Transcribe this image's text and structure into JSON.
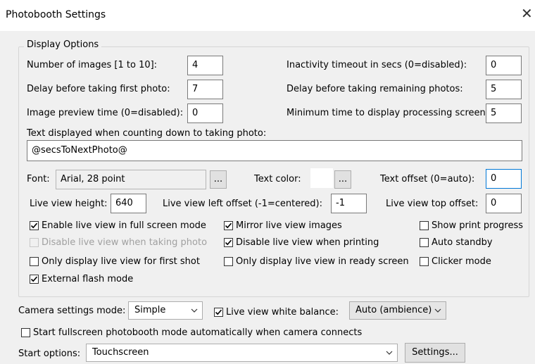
{
  "window": {
    "title": "Photobooth Settings",
    "close_glyph": "✕"
  },
  "display_options": {
    "legend": "Display Options",
    "num_images": {
      "label": "Number of images [1 to 10]:",
      "value": "4"
    },
    "delay_first": {
      "label": "Delay before taking first photo:",
      "value": "7"
    },
    "preview_time": {
      "label": "Image preview time (0=disabled):",
      "value": "0"
    },
    "inactivity": {
      "label": "Inactivity timeout in secs (0=disabled):",
      "value": "0"
    },
    "delay_remaining": {
      "label": "Delay before taking remaining photos:",
      "value": "5"
    },
    "min_processing": {
      "label": "Minimum time to display processing screen:",
      "value": "5"
    },
    "countdown_text": {
      "label": "Text displayed when counting down to taking photo:",
      "value": "@secsToNextPhoto@"
    },
    "font": {
      "label": "Font:",
      "value": "Arial, 28 point",
      "browse": "..."
    },
    "text_color": {
      "label": "Text color:",
      "swatch": "#ffffff",
      "browse": "..."
    },
    "text_offset": {
      "label": "Text offset (0=auto):",
      "value": "0"
    },
    "lv_height": {
      "label": "Live view height:",
      "value": "640"
    },
    "lv_left": {
      "label": "Live view left offset (-1=centered):",
      "value": "-1"
    },
    "lv_top": {
      "label": "Live view top offset:",
      "value": "0"
    },
    "checkboxes": [
      {
        "label": "Enable live view in full screen mode",
        "checked": true,
        "enabled": true
      },
      {
        "label": "Disable live view when taking photo",
        "checked": false,
        "enabled": false
      },
      {
        "label": "Only display live view for first shot",
        "checked": false,
        "enabled": true
      },
      {
        "label": "External flash mode",
        "checked": true,
        "enabled": true
      },
      {
        "label": "Mirror live view images",
        "checked": true,
        "enabled": true
      },
      {
        "label": "Disable live view when printing",
        "checked": true,
        "enabled": true
      },
      {
        "label": "Only display live view in ready screen",
        "checked": false,
        "enabled": true
      },
      {
        "label": "Show print progress",
        "checked": false,
        "enabled": true
      },
      {
        "label": "Auto standby",
        "checked": false,
        "enabled": true
      },
      {
        "label": "Clicker mode",
        "checked": false,
        "enabled": true
      }
    ]
  },
  "camera": {
    "mode_label": "Camera settings mode:",
    "mode_value": "Simple",
    "wb_checkbox": {
      "label": "Live view white balance:",
      "checked": true
    },
    "wb_value": "Auto (ambience)"
  },
  "autostart": {
    "label": "Start fullscreen photobooth mode automatically when camera connects",
    "checked": false
  },
  "start": {
    "label": "Start options:",
    "value": "Touchscreen",
    "settings_button": "Settings..."
  },
  "colors": {
    "focus_border": "#0078d7",
    "window_bg": "#f0f0f0",
    "titlebar_bg": "#ffffff"
  },
  "icons": {
    "close": "close-icon",
    "dropdown": "chevron-down-icon",
    "check": "checkmark-icon"
  }
}
